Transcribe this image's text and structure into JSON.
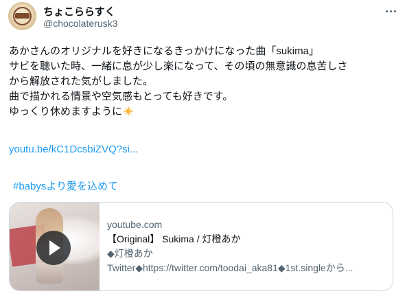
{
  "author": {
    "display_name": "ちょこららすく",
    "handle": "@chocolaterusk3",
    "avatar_icon": "avatar-logo"
  },
  "menu_icon": "more-icon",
  "tweet": {
    "lines": [
      "あかさんのオリジナルを好きになるきっかけになった曲「sukima」",
      "サビを聴いた時、一緒に息が少し楽になって、その頃の無意識の息苦しさ",
      "から解放された気がしました。",
      "曲で描かれる情景や空気感もとっても好きです。",
      "ゆっくり休めますように"
    ],
    "emoji_icon": "sun-emoji-icon",
    "link": "youtu.be/kC1DcsbiZVQ?si...",
    "hashtag": "#babysより愛を込めて"
  },
  "card": {
    "domain": "youtube.com",
    "title": "【Original】 Sukima / 灯橙あか",
    "desc_line1": "◆灯橙あか",
    "desc_line2": "Twitter◆https://twitter.com/toodai_aka81◆1st.singleから..."
  },
  "colors": {
    "link": "#1d9bf0",
    "text": "#0f1419",
    "secondary": "#536471",
    "border": "#cfd9de"
  }
}
